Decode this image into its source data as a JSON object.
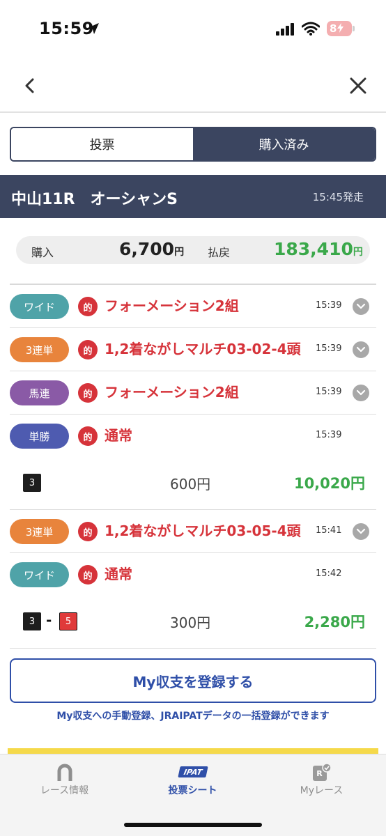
{
  "status_bar": {
    "time": "15:59",
    "battery": "8"
  },
  "tabs": {
    "vote": "投票",
    "purchased": "購入済み"
  },
  "race": {
    "title": "中山11R　オーシャンS",
    "post_time": "15:45発走"
  },
  "summary": {
    "purchase_label": "購入",
    "purchase_value": "6,700",
    "payout_label": "払戻",
    "payout_value": "183,410",
    "yen": "円"
  },
  "bets": [
    {
      "type": "ワイド",
      "type_color": "#4fa3a8",
      "mark": "的",
      "desc": "フォーメーション2組",
      "time": "15:39",
      "expandable": true
    },
    {
      "type": "3連単",
      "type_color": "#e8843c",
      "mark": "的",
      "desc": "1,2着ながしマルチ03-02-4頭",
      "time": "15:39",
      "expandable": true
    },
    {
      "type": "馬連",
      "type_color": "#8a5aa6",
      "mark": "的",
      "desc": "フォーメーション2組",
      "time": "15:39",
      "expandable": true
    },
    {
      "type": "単勝",
      "type_color": "#4e5bb0",
      "mark": "的",
      "desc": "通常",
      "time": "15:39",
      "expandable": false
    },
    {
      "type": "3連単",
      "type_color": "#e8843c",
      "mark": "的",
      "desc": "1,2着ながしマルチ03-05-4頭",
      "time": "15:41",
      "expandable": true
    },
    {
      "type": "ワイド",
      "type_color": "#4fa3a8",
      "mark": "的",
      "desc": "通常",
      "time": "15:42",
      "expandable": false
    }
  ],
  "results": [
    {
      "horses": [
        "3"
      ],
      "stake": "600円",
      "payout": "10,020円"
    },
    {
      "horses": [
        "3",
        "5"
      ],
      "separator": "-",
      "stake": "300円",
      "payout": "2,280円"
    }
  ],
  "register": {
    "button": "My収支を登録する",
    "note": "My収支への手動登録、JRAIPATデータの一括登録ができます"
  },
  "bottom_tabs": [
    {
      "label": "レース情報",
      "icon": "horseshoe-icon"
    },
    {
      "label": "投票シート",
      "icon": "ipat-icon",
      "logo": "IPAT",
      "active": true
    },
    {
      "label": "Myレース",
      "icon": "my-race-icon",
      "icon_letter": "R"
    }
  ]
}
